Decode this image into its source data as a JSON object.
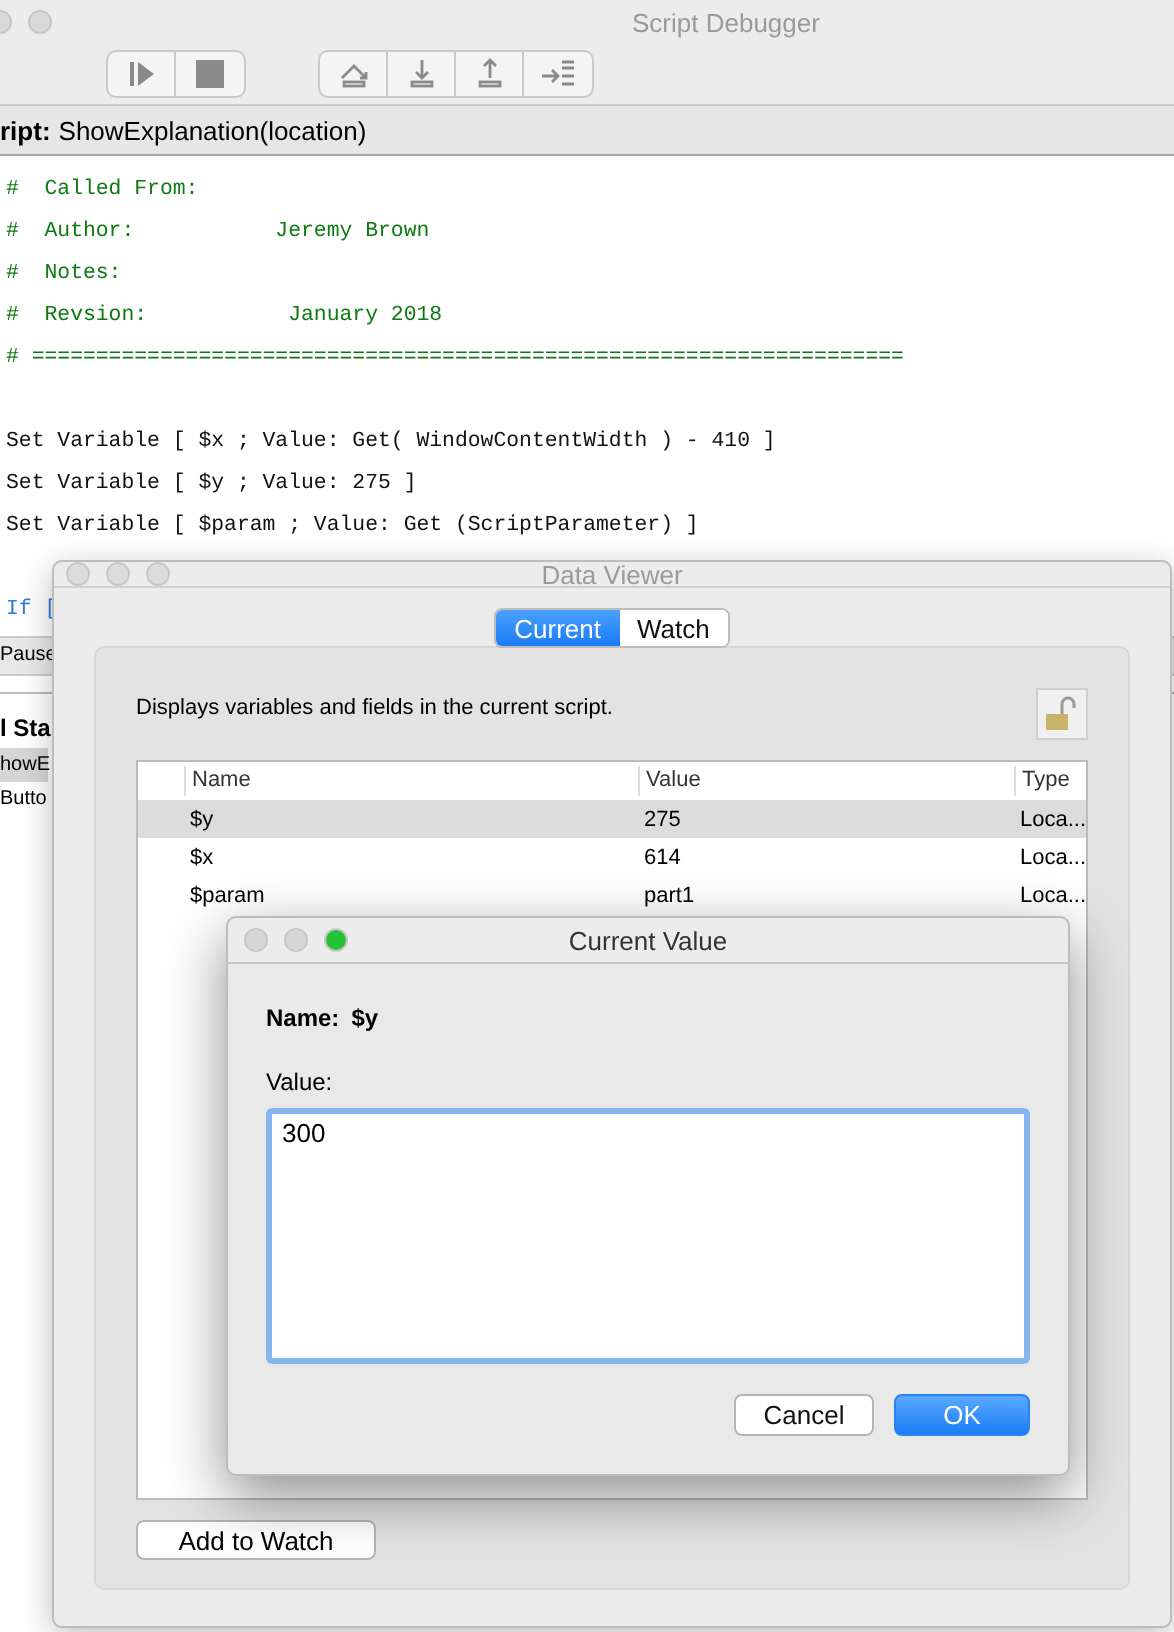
{
  "debugger": {
    "title": "Script Debugger",
    "script_label": "ript:",
    "script_name": "ShowExplanation(location)",
    "code_lines": [
      {
        "kind": "comment",
        "text": "#  Called From:"
      },
      {
        "kind": "comment",
        "text": "#  Author:           Jeremy Brown"
      },
      {
        "kind": "comment",
        "text": "#  Notes:"
      },
      {
        "kind": "comment",
        "text": "#  Revsion:           January 2018"
      },
      {
        "kind": "comment",
        "text": "# ===================================================================="
      },
      {
        "kind": "blank"
      },
      {
        "kind": "code",
        "text": "Set Variable [ $x ; Value: Get( WindowContentWidth ) - 410 ]"
      },
      {
        "kind": "code",
        "text": "Set Variable [ $y ; Value: 275 ]"
      },
      {
        "kind": "code",
        "text": "Set Variable [ $param ; Value: Get (ScriptParameter) ]"
      },
      {
        "kind": "blank"
      },
      {
        "kind": "keyword",
        "text": "If ["
      }
    ],
    "status": "Pause",
    "panel_heading": "l Sta",
    "list": [
      {
        "text": "howE",
        "selected": true
      },
      {
        "text": "Butto",
        "selected": false
      }
    ]
  },
  "data_viewer": {
    "title": "Data Viewer",
    "tabs": [
      {
        "label": "Current",
        "selected": true
      },
      {
        "label": "Watch",
        "selected": false
      }
    ],
    "description": "Displays variables and fields in the current script.",
    "columns": [
      "Name",
      "Value",
      "Type"
    ],
    "rows": [
      {
        "name": "$y",
        "value": "275",
        "type": "Loca...",
        "selected": true
      },
      {
        "name": "$x",
        "value": "614",
        "type": "Loca...",
        "selected": false
      },
      {
        "name": "$param",
        "value": "part1",
        "type": "Loca...",
        "selected": false
      }
    ],
    "add_button": "Add to Watch"
  },
  "current_value": {
    "title": "Current Value",
    "name_label": "Name:",
    "name": "$y",
    "value_label": "Value:",
    "value": "300",
    "buttons": [
      {
        "label": "Cancel",
        "kind": "default"
      },
      {
        "label": "OK",
        "kind": "primary"
      }
    ]
  }
}
